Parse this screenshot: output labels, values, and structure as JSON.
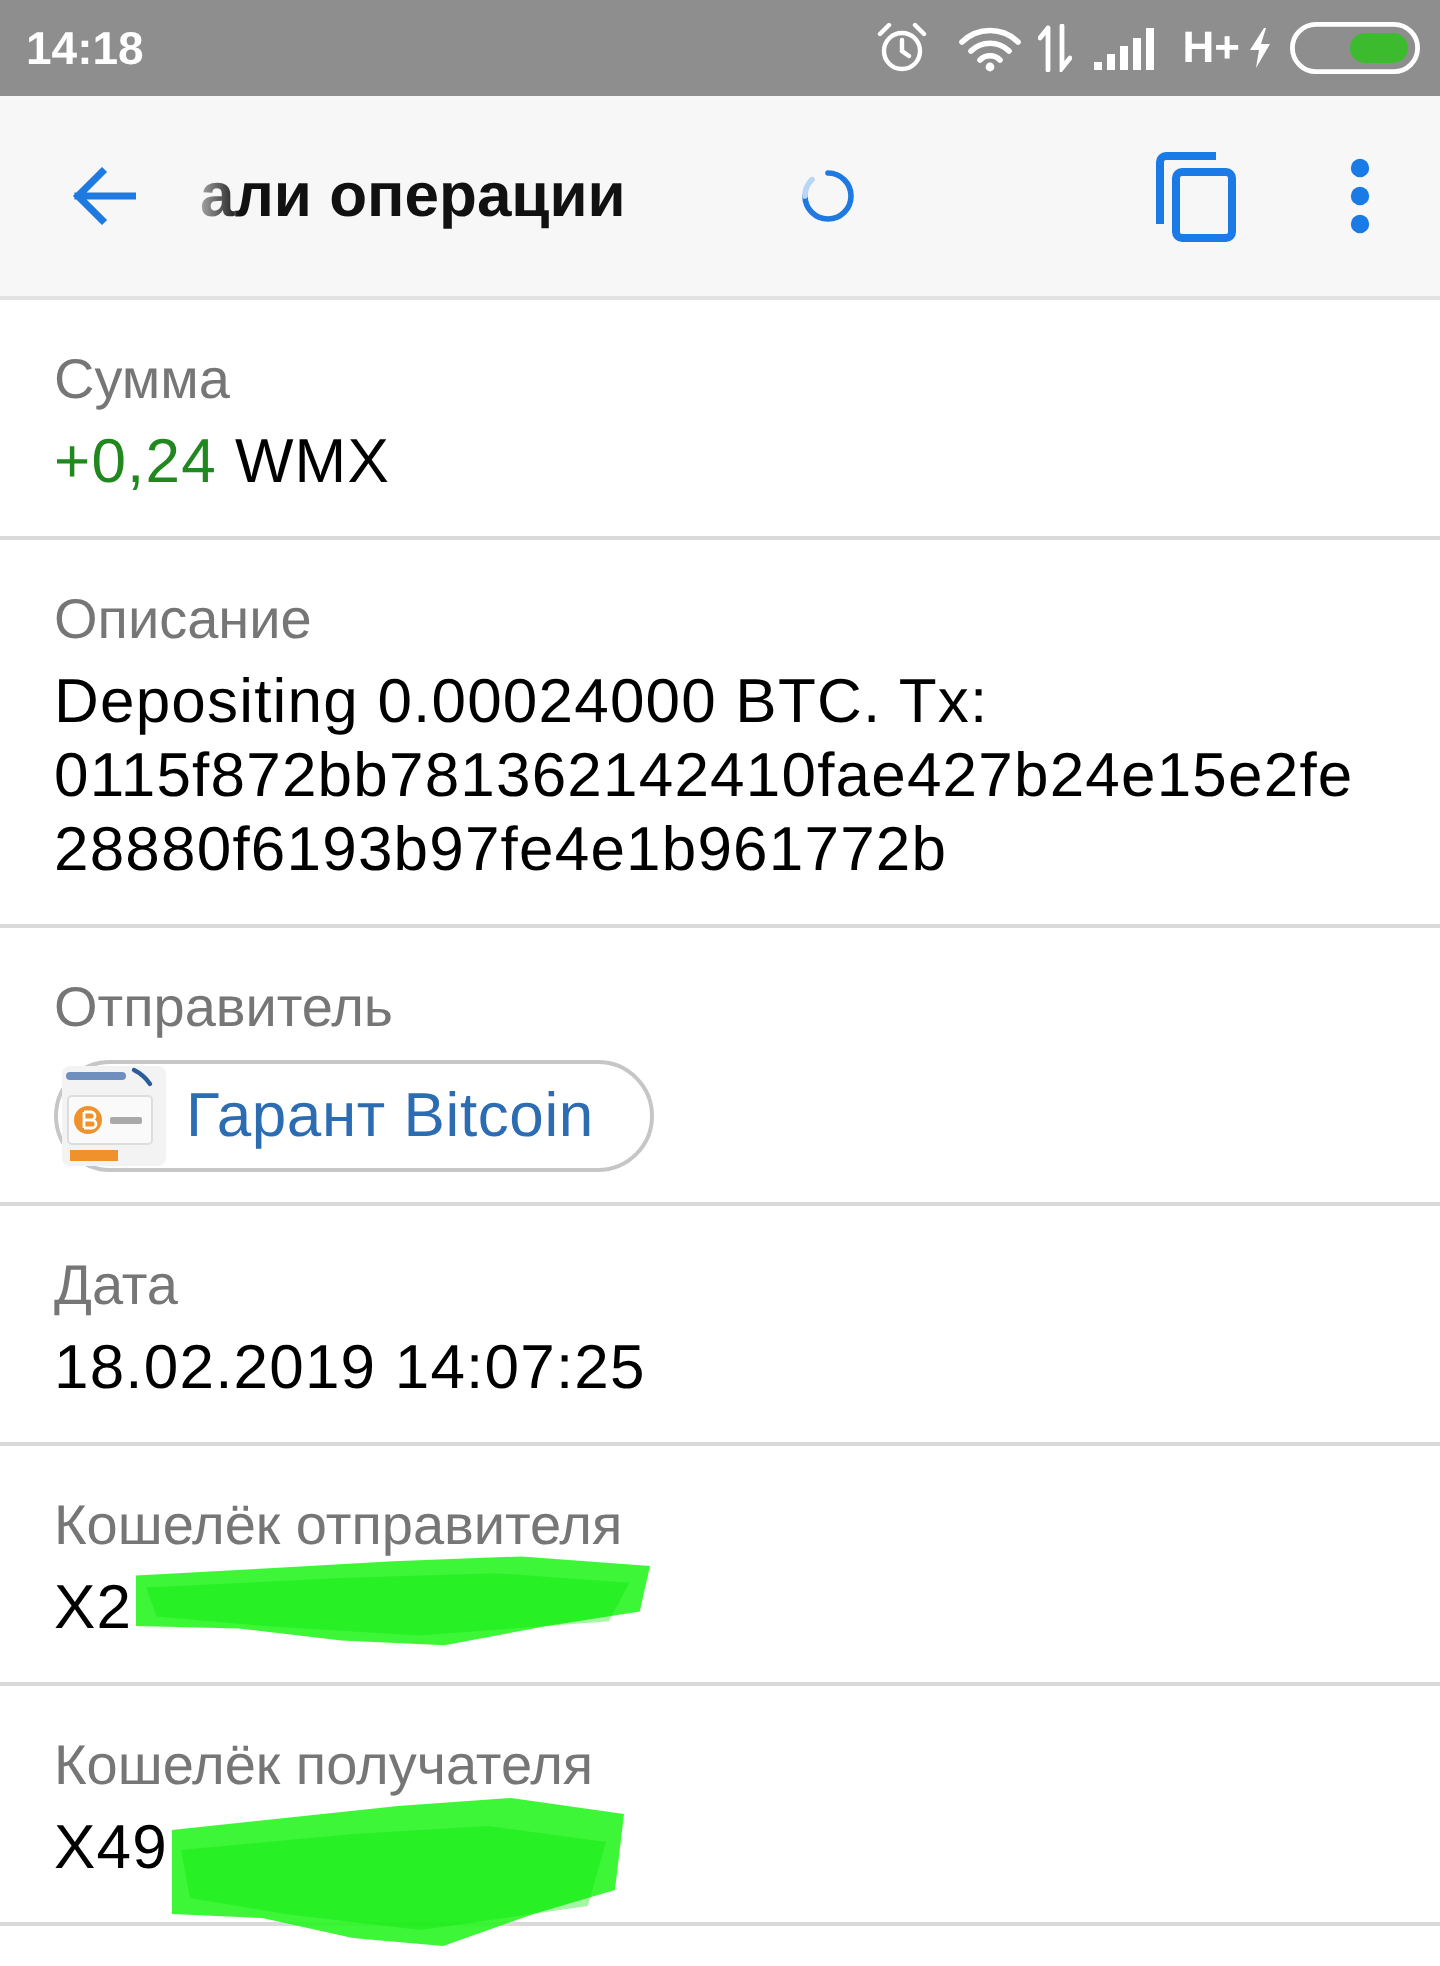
{
  "status_bar": {
    "time": "14:18",
    "network_type": "H+"
  },
  "app_bar": {
    "title": "али операции",
    "loading": true
  },
  "fields": [
    {
      "kind": "amount",
      "label": "Сумма",
      "amount": "+0,24",
      "currency": "WMX",
      "incoming": true,
      "redacted": false
    },
    {
      "kind": "text",
      "label": "Описание",
      "value": "Depositing 0.00024000 BTC. Tx: 0115f872bb781362142410fae427b24e15e2fe28880f6193b97fe4e1b961772b",
      "redacted": false
    },
    {
      "kind": "contact",
      "label": "Отправитель",
      "value": "Гарант Bitcoin",
      "redacted": false
    },
    {
      "kind": "text",
      "label": "Дата",
      "value": "18.02.2019 14:07:25",
      "redacted": false
    },
    {
      "kind": "text",
      "label": "Кошелёк отправителя",
      "value": "X2",
      "redacted": true
    },
    {
      "kind": "text",
      "label": "Кошелёк получателя",
      "value": "X49",
      "redacted": true
    }
  ]
}
